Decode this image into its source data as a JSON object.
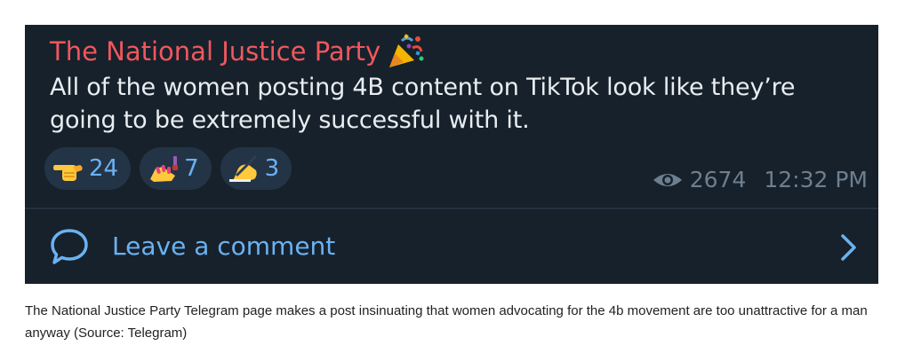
{
  "post": {
    "channel_name": "The National Justice Party",
    "title_emoji": "party-popper-icon",
    "message": "All of the women posting 4B content on TikTok look like they’re going to be extremely successful with it.",
    "reactions": [
      {
        "icon": "pointing-hand-icon",
        "count": "24"
      },
      {
        "icon": "nail-polish-icon",
        "count": "7"
      },
      {
        "icon": "writing-hand-icon",
        "count": "3"
      }
    ],
    "views": "2674",
    "time": "12:32 PM",
    "comment_label": "Leave a comment"
  },
  "caption": "The National Justice Party Telegram page makes a post insinuating that women advocating for the 4b movement are too unattractive for a man anyway (Source: Telegram)",
  "colors": {
    "background": "#17212b",
    "channel_name": "#f0575d",
    "accent": "#6ab2f2",
    "text": "#e8edf1",
    "meta": "#6d7f8f"
  }
}
